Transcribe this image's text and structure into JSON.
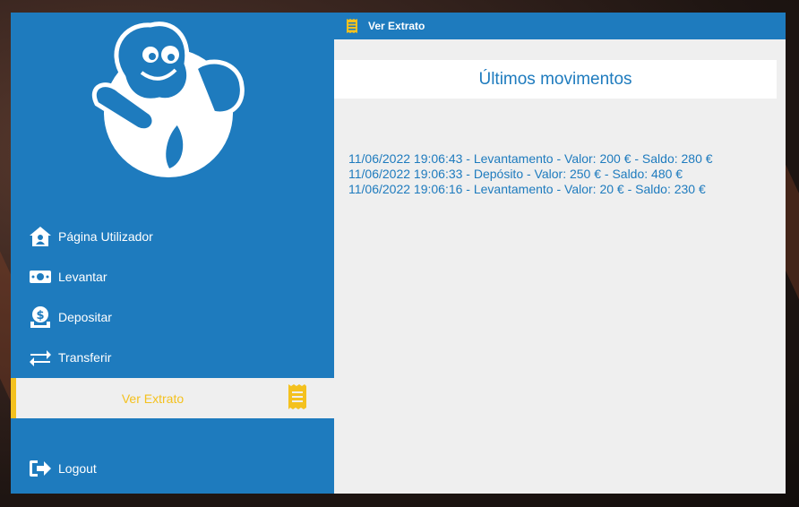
{
  "colors": {
    "sidebar_blue": "#1e7bbe",
    "accent_yellow": "#f4c11e",
    "content_bg": "#efefef",
    "text_white": "#ffffff"
  },
  "topbar": {
    "title": "Ver Extrato",
    "icon": "receipt-icon"
  },
  "sidebar": {
    "logo": "mascot-logo",
    "items": [
      {
        "label": "Página Utilizador",
        "icon": "user-home-icon"
      },
      {
        "label": "Levantar",
        "icon": "money-icon"
      },
      {
        "label": "Depositar",
        "icon": "deposit-icon"
      },
      {
        "label": "Transferir",
        "icon": "transfer-arrows-icon"
      },
      {
        "label": "Ver Extrato",
        "icon": "receipt-icon",
        "active": true
      }
    ],
    "logout": {
      "label": "Logout",
      "icon": "logout-icon"
    }
  },
  "main": {
    "header": "Últimos movimentos",
    "movements": [
      "11/06/2022 19:06:43 - Levantamento - Valor: 200 € - Saldo: 280 €",
      "11/06/2022 19:06:33 - Depósito - Valor: 250 € - Saldo: 480 €",
      "11/06/2022 19:06:16 - Levantamento - Valor: 20 € - Saldo: 230 €"
    ]
  }
}
